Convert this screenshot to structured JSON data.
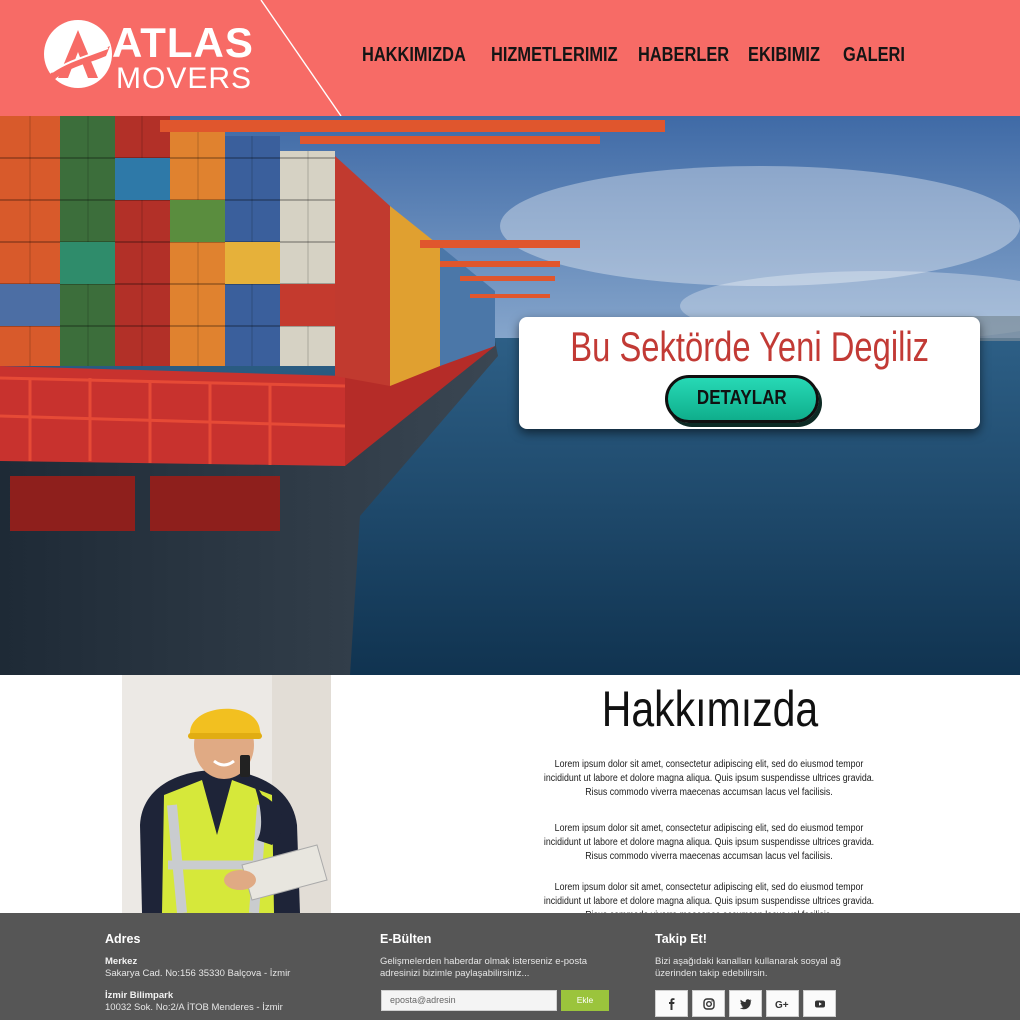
{
  "brand": {
    "name_line1": "ATLAS",
    "name_line2": "MOVERS",
    "header_color": "#f76b66"
  },
  "nav": {
    "items": [
      {
        "label": "HAKKIMIZDA"
      },
      {
        "label": "HIZMETLERIMIZ"
      },
      {
        "label": "HABERLER"
      },
      {
        "label": "EKIBIMIZ"
      },
      {
        "label": "GALERI"
      }
    ]
  },
  "hero": {
    "title": "Bu Sektörde Yeni Degiliz",
    "button_label": "DETAYLAR",
    "title_color": "#c23a35",
    "button_color": "#1cc6a1"
  },
  "about": {
    "heading": "Hakkımızda",
    "paragraphs": [
      "Lorem ipsum dolor sit amet, consectetur adipiscing elit, sed do eiusmod tempor incididunt ut labore et dolore magna aliqua. Quis ipsum suspendisse ultrices gravida. Risus commodo viverra maecenas accumsan lacus vel facilisis.",
      "Lorem ipsum dolor sit amet, consectetur adipiscing elit, sed do eiusmod tempor incididunt ut labore et dolore magna aliqua. Quis ipsum suspendisse ultrices gravida. Risus commodo viverra maecenas accumsan lacus vel facilisis.",
      "Lorem ipsum dolor sit amet, consectetur adipiscing elit, sed do eiusmod tempor incididunt ut labore et dolore magna aliqua. Quis ipsum suspendisse ultrices gravida. Risus commodo viverra maecenas accumsan lacus vel facilisis."
    ]
  },
  "footer": {
    "address": {
      "title": "Adres",
      "merkez_label": "Merkez",
      "merkez_text": "Sakarya Cad. No:156 35330 Balçova - İzmir",
      "branch_label": "İzmir Bilimpark",
      "branch_text": "10032 Sok. No:2/A İTOB Menderes - İzmir"
    },
    "newsletter": {
      "title": "E-Bülten",
      "line1": "Gelişmelerden haberdar olmak isterseniz e-posta",
      "line2": "adresinizi bizimle paylaşabilirsiniz...",
      "placeholder": "eposta@adresin",
      "button_label": "Ekle",
      "button_color": "#9bc43c"
    },
    "follow": {
      "title": "Takip Et!",
      "line1": "Bizi aşağıdaki kanalları kullanarak sosyal ağ",
      "line2": "üzerinden takip edebilirsin.",
      "icons": [
        "facebook-icon",
        "instagram-icon",
        "twitter-icon",
        "google-plus-icon",
        "youtube-icon"
      ]
    },
    "background_color": "#565656"
  }
}
